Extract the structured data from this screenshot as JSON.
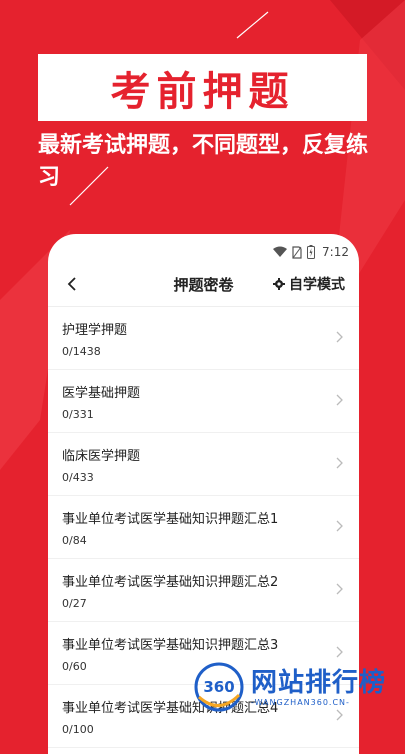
{
  "banner": {
    "title": "考前押题"
  },
  "subtitle": "最新考试押题，不同题型，反复练习",
  "status_bar": {
    "time": "7:12"
  },
  "nav": {
    "title": "押题密卷",
    "mode_label": "自学模式"
  },
  "items": [
    {
      "title": "护理学押题",
      "count": "0/1438"
    },
    {
      "title": "医学基础押题",
      "count": "0/331"
    },
    {
      "title": "临床医学押题",
      "count": "0/433"
    },
    {
      "title": "事业单位考试医学基础知识押题汇总1",
      "count": "0/84"
    },
    {
      "title": "事业单位考试医学基础知识押题汇总2",
      "count": "0/27"
    },
    {
      "title": "事业单位考试医学基础知识押题汇总3",
      "count": "0/60"
    },
    {
      "title": "事业单位考试医学基础知识押题汇总4",
      "count": "0/100"
    }
  ],
  "watermark": {
    "logo_text": "360",
    "main": "网站排行榜",
    "sub": "-WANGZHAN360.CN-"
  },
  "colors": {
    "brand_red": "#e5222e",
    "watermark_blue": "#1f5fc8"
  },
  "icons": [
    "wifi-icon",
    "sim-icon",
    "battery-icon",
    "back-chevron-icon",
    "gear-icon",
    "chevron-right-icon",
    "logo-360-icon"
  ]
}
